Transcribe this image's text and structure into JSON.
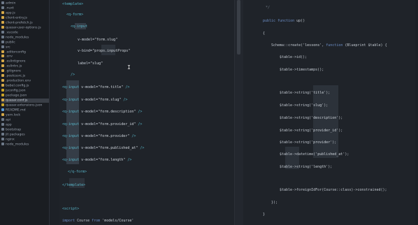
{
  "explorer": {
    "items": [
      {
        "label": "admin",
        "type": "folder"
      },
      {
        "label": ".nuxt",
        "type": "folder"
      },
      {
        "label": "app.js",
        "type": "file"
      },
      {
        "label": "client-entry.js",
        "type": "file"
      },
      {
        "label": "client-prefetch.js",
        "type": "file"
      },
      {
        "label": "quasar-user-options.js",
        "type": "file"
      },
      {
        "label": ".vscode",
        "type": "folder"
      },
      {
        "label": "node_modules",
        "type": "folder"
      },
      {
        "label": "public",
        "type": "folder"
      },
      {
        "label": "src",
        "type": "folder"
      },
      {
        "label": ".editorconfig",
        "type": "file"
      },
      {
        "label": ".env",
        "type": "file"
      },
      {
        "label": ".eslintignore",
        "type": "file"
      },
      {
        "label": ".eslintrc.js",
        "type": "file"
      },
      {
        "label": ".gitignore",
        "type": "file"
      },
      {
        "label": ".postcssrc.js",
        "type": "file"
      },
      {
        "label": ".production.env",
        "type": "file"
      },
      {
        "label": "babel.config.js",
        "type": "file"
      },
      {
        "label": "jsconfig.json",
        "type": "file"
      },
      {
        "label": "package.json",
        "type": "file"
      },
      {
        "label": "quasar.conf.js",
        "type": "file",
        "active": true
      },
      {
        "label": "quasar.extensions.json",
        "type": "file"
      },
      {
        "label": "README.md",
        "type": "file"
      },
      {
        "label": "yarn.lock",
        "type": "file"
      },
      {
        "label": "api",
        "type": "folder"
      },
      {
        "label": "app",
        "type": "folder"
      },
      {
        "label": "bootstrap",
        "type": "folder"
      },
      {
        "label": "jit packages",
        "type": "folder"
      },
      {
        "label": "nginx",
        "type": "folder"
      },
      {
        "label": "node_modules",
        "type": "folder"
      }
    ]
  },
  "left_code": [
    {
      "indent": 0,
      "parts": [
        {
          "c": "tag",
          "t": "<template>"
        }
      ]
    },
    {
      "indent": 1,
      "parts": [
        {
          "c": "tag",
          "t": "<q-form>"
        }
      ]
    },
    {
      "indent": 2,
      "parts": [
        {
          "c": "tag",
          "t": "<q-input"
        }
      ]
    },
    {
      "indent": 3,
      "parts": [
        {
          "c": "attr",
          "t": "v-model="
        },
        {
          "c": "str",
          "t": "\"form.slug\""
        }
      ]
    },
    {
      "indent": 3,
      "parts": [
        {
          "c": "attr",
          "t": "v-bind="
        },
        {
          "c": "str",
          "t": "\"props.inputProps\""
        }
      ]
    },
    {
      "indent": 3,
      "parts": [
        {
          "c": "attr",
          "t": "label="
        },
        {
          "c": "str",
          "t": "\"slug\""
        }
      ]
    },
    {
      "indent": 2,
      "parts": [
        {
          "c": "tag",
          "t": "/>"
        }
      ]
    },
    {
      "indent": 0,
      "parts": [
        {
          "c": "tag",
          "t": "<q-input"
        },
        {
          "c": "attr",
          "t": " v-model="
        },
        {
          "c": "str",
          "t": "\"form.title\""
        },
        {
          "c": "tag",
          "t": " />"
        }
      ]
    },
    {
      "indent": 0,
      "parts": [
        {
          "c": "tag",
          "t": "<q-input"
        },
        {
          "c": "attr",
          "t": " v-model="
        },
        {
          "c": "str",
          "t": "\"form.slug\""
        },
        {
          "c": "tag",
          "t": " />"
        }
      ]
    },
    {
      "indent": 0,
      "parts": [
        {
          "c": "tag",
          "t": "<q-input"
        },
        {
          "c": "attr",
          "t": " v-model="
        },
        {
          "c": "str",
          "t": "\"form.description\""
        },
        {
          "c": "tag",
          "t": " />"
        }
      ]
    },
    {
      "indent": 0,
      "parts": [
        {
          "c": "tag",
          "t": "<q-input"
        },
        {
          "c": "attr",
          "t": " v-model="
        },
        {
          "c": "str",
          "t": "\"form.provider_id\""
        },
        {
          "c": "tag",
          "t": " />"
        }
      ]
    },
    {
      "indent": 0,
      "parts": [
        {
          "c": "tag",
          "t": "<q-input"
        },
        {
          "c": "attr",
          "t": " v-model="
        },
        {
          "c": "str",
          "t": "\"form.provider\""
        },
        {
          "c": "tag",
          "t": " />"
        }
      ]
    },
    {
      "indent": 0,
      "parts": [
        {
          "c": "tag",
          "t": "<q-input"
        },
        {
          "c": "attr",
          "t": " v-model="
        },
        {
          "c": "str",
          "t": "\"form.published_at\""
        },
        {
          "c": "tag",
          "t": " />"
        }
      ]
    },
    {
      "indent": 0,
      "parts": [
        {
          "c": "tag",
          "t": "<q-input"
        },
        {
          "c": "attr",
          "t": " v-model="
        },
        {
          "c": "str",
          "t": "\"form.length\""
        },
        {
          "c": "tag",
          "t": " />"
        }
      ]
    },
    {
      "indent": 1,
      "parts": [
        {
          "c": "tag",
          "t": "</q-form>"
        }
      ]
    },
    {
      "indent": 0,
      "parts": [
        {
          "c": "tag",
          "t": "</template>"
        }
      ]
    },
    {
      "indent": 0,
      "parts": [
        {
          "c": "tag",
          "t": "<script>"
        }
      ]
    },
    {
      "indent": 0,
      "parts": [
        {
          "c": "kw",
          "t": "import"
        },
        {
          "c": "plain",
          "t": " Course "
        },
        {
          "c": "kw",
          "t": "from"
        },
        {
          "c": "str",
          "t": " 'models/Course'"
        }
      ]
    }
  ],
  "right_code": [
    {
      "parts": [
        {
          "c": "comment",
          "t": "*/"
        }
      ]
    },
    {
      "parts": [
        {
          "c": "kw",
          "t": "public function"
        },
        {
          "c": "plain",
          "t": " up()"
        }
      ]
    },
    {
      "parts": [
        {
          "c": "plain",
          "t": "{"
        }
      ]
    },
    {
      "parts": [
        {
          "c": "plain",
          "t": "Schema::create("
        },
        {
          "c": "str",
          "t": "'lessons'"
        },
        {
          "c": "plain",
          "t": ", "
        },
        {
          "c": "kw",
          "t": "function"
        },
        {
          "c": "plain",
          "t": " (Blueprint $table) {"
        }
      ]
    },
    {
      "parts": [
        {
          "c": "plain",
          "t": "$table->id();"
        }
      ]
    },
    {
      "parts": [
        {
          "c": "plain",
          "t": "$table->timestamps();"
        }
      ]
    },
    {
      "parts": [
        {
          "c": "plain",
          "t": "$table->string("
        },
        {
          "c": "str",
          "t": "'title'"
        },
        {
          "c": "plain",
          "t": ");"
        }
      ]
    },
    {
      "parts": [
        {
          "c": "plain",
          "t": "$table->string("
        },
        {
          "c": "str",
          "t": "'slug'"
        },
        {
          "c": "plain",
          "t": ");"
        }
      ]
    },
    {
      "parts": [
        {
          "c": "plain",
          "t": "$table->string("
        },
        {
          "c": "str",
          "t": "'description'"
        },
        {
          "c": "plain",
          "t": ");"
        }
      ]
    },
    {
      "parts": [
        {
          "c": "plain",
          "t": "$table->string("
        },
        {
          "c": "str",
          "t": "'provider_id'"
        },
        {
          "c": "plain",
          "t": ");"
        }
      ]
    },
    {
      "parts": [
        {
          "c": "plain",
          "t": "$table->string("
        },
        {
          "c": "str",
          "t": "'provider'"
        },
        {
          "c": "plain",
          "t": ");"
        }
      ]
    },
    {
      "parts": [
        {
          "c": "plain",
          "t": "$table->datetime("
        },
        {
          "c": "str",
          "t": "'published_at'"
        },
        {
          "c": "plain",
          "t": ");"
        }
      ]
    },
    {
      "parts": [
        {
          "c": "plain",
          "t": "$table->string("
        },
        {
          "c": "str",
          "t": "'length'"
        },
        {
          "c": "plain",
          "t": ");"
        }
      ]
    },
    {
      "parts": [
        {
          "c": "plain",
          "t": "$table->foreignIdFor(Course::class)->constrained();"
        }
      ]
    },
    {
      "parts": [
        {
          "c": "plain",
          "t": "});"
        }
      ]
    },
    {
      "parts": [
        {
          "c": "plain",
          "t": "}"
        }
      ]
    }
  ],
  "colors": {
    "background": "#1f2329",
    "tag": "#58b6c9",
    "keyword": "#6d8fc8",
    "selection": "#3a424c"
  }
}
